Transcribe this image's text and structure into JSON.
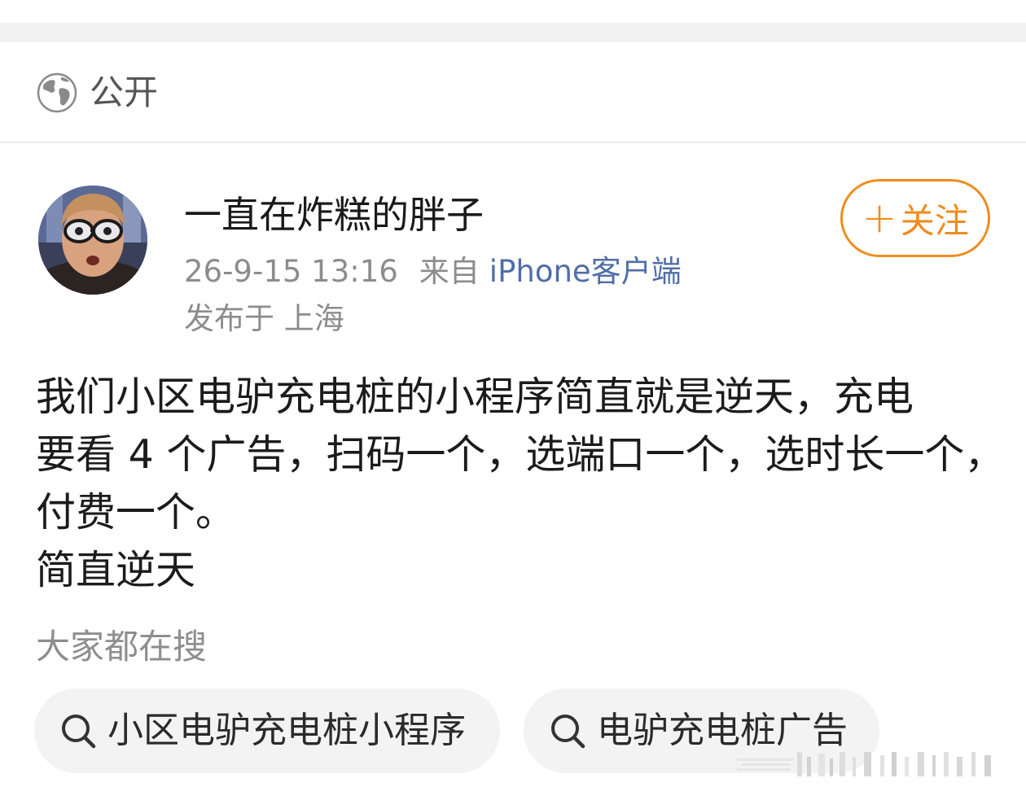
{
  "visibility": {
    "icon": "globe-icon",
    "label": "公开"
  },
  "post": {
    "author": {
      "name": "一直在炸糕的胖子",
      "avatar": "avatar-photo"
    },
    "timestamp": "26-9-15 13:16",
    "source_label": "来自",
    "source_device": "iPhone客户端",
    "location": "发布于 上海",
    "follow_button": {
      "icon": "plus-icon",
      "label": "关注"
    },
    "content": [
      "我们小区电驴充电桩的小程序简直就是逆天，充电",
      "要看 4 个广告，扫码一个，选端口一个，选时长一个，",
      "付费一个。",
      "简直逆天"
    ]
  },
  "trending": {
    "header": "大家都在搜",
    "items": [
      {
        "icon": "search-icon",
        "label": "小区电驴充电桩小程序"
      },
      {
        "icon": "search-icon",
        "label": "电驴充电桩广告"
      }
    ]
  },
  "colors": {
    "accent_orange": "#ef8c1d",
    "link_blue": "#506ea8",
    "meta_gray": "#8c8c8c",
    "pill_bg": "#f3f3f3",
    "band_gray": "#f1f1f1"
  }
}
